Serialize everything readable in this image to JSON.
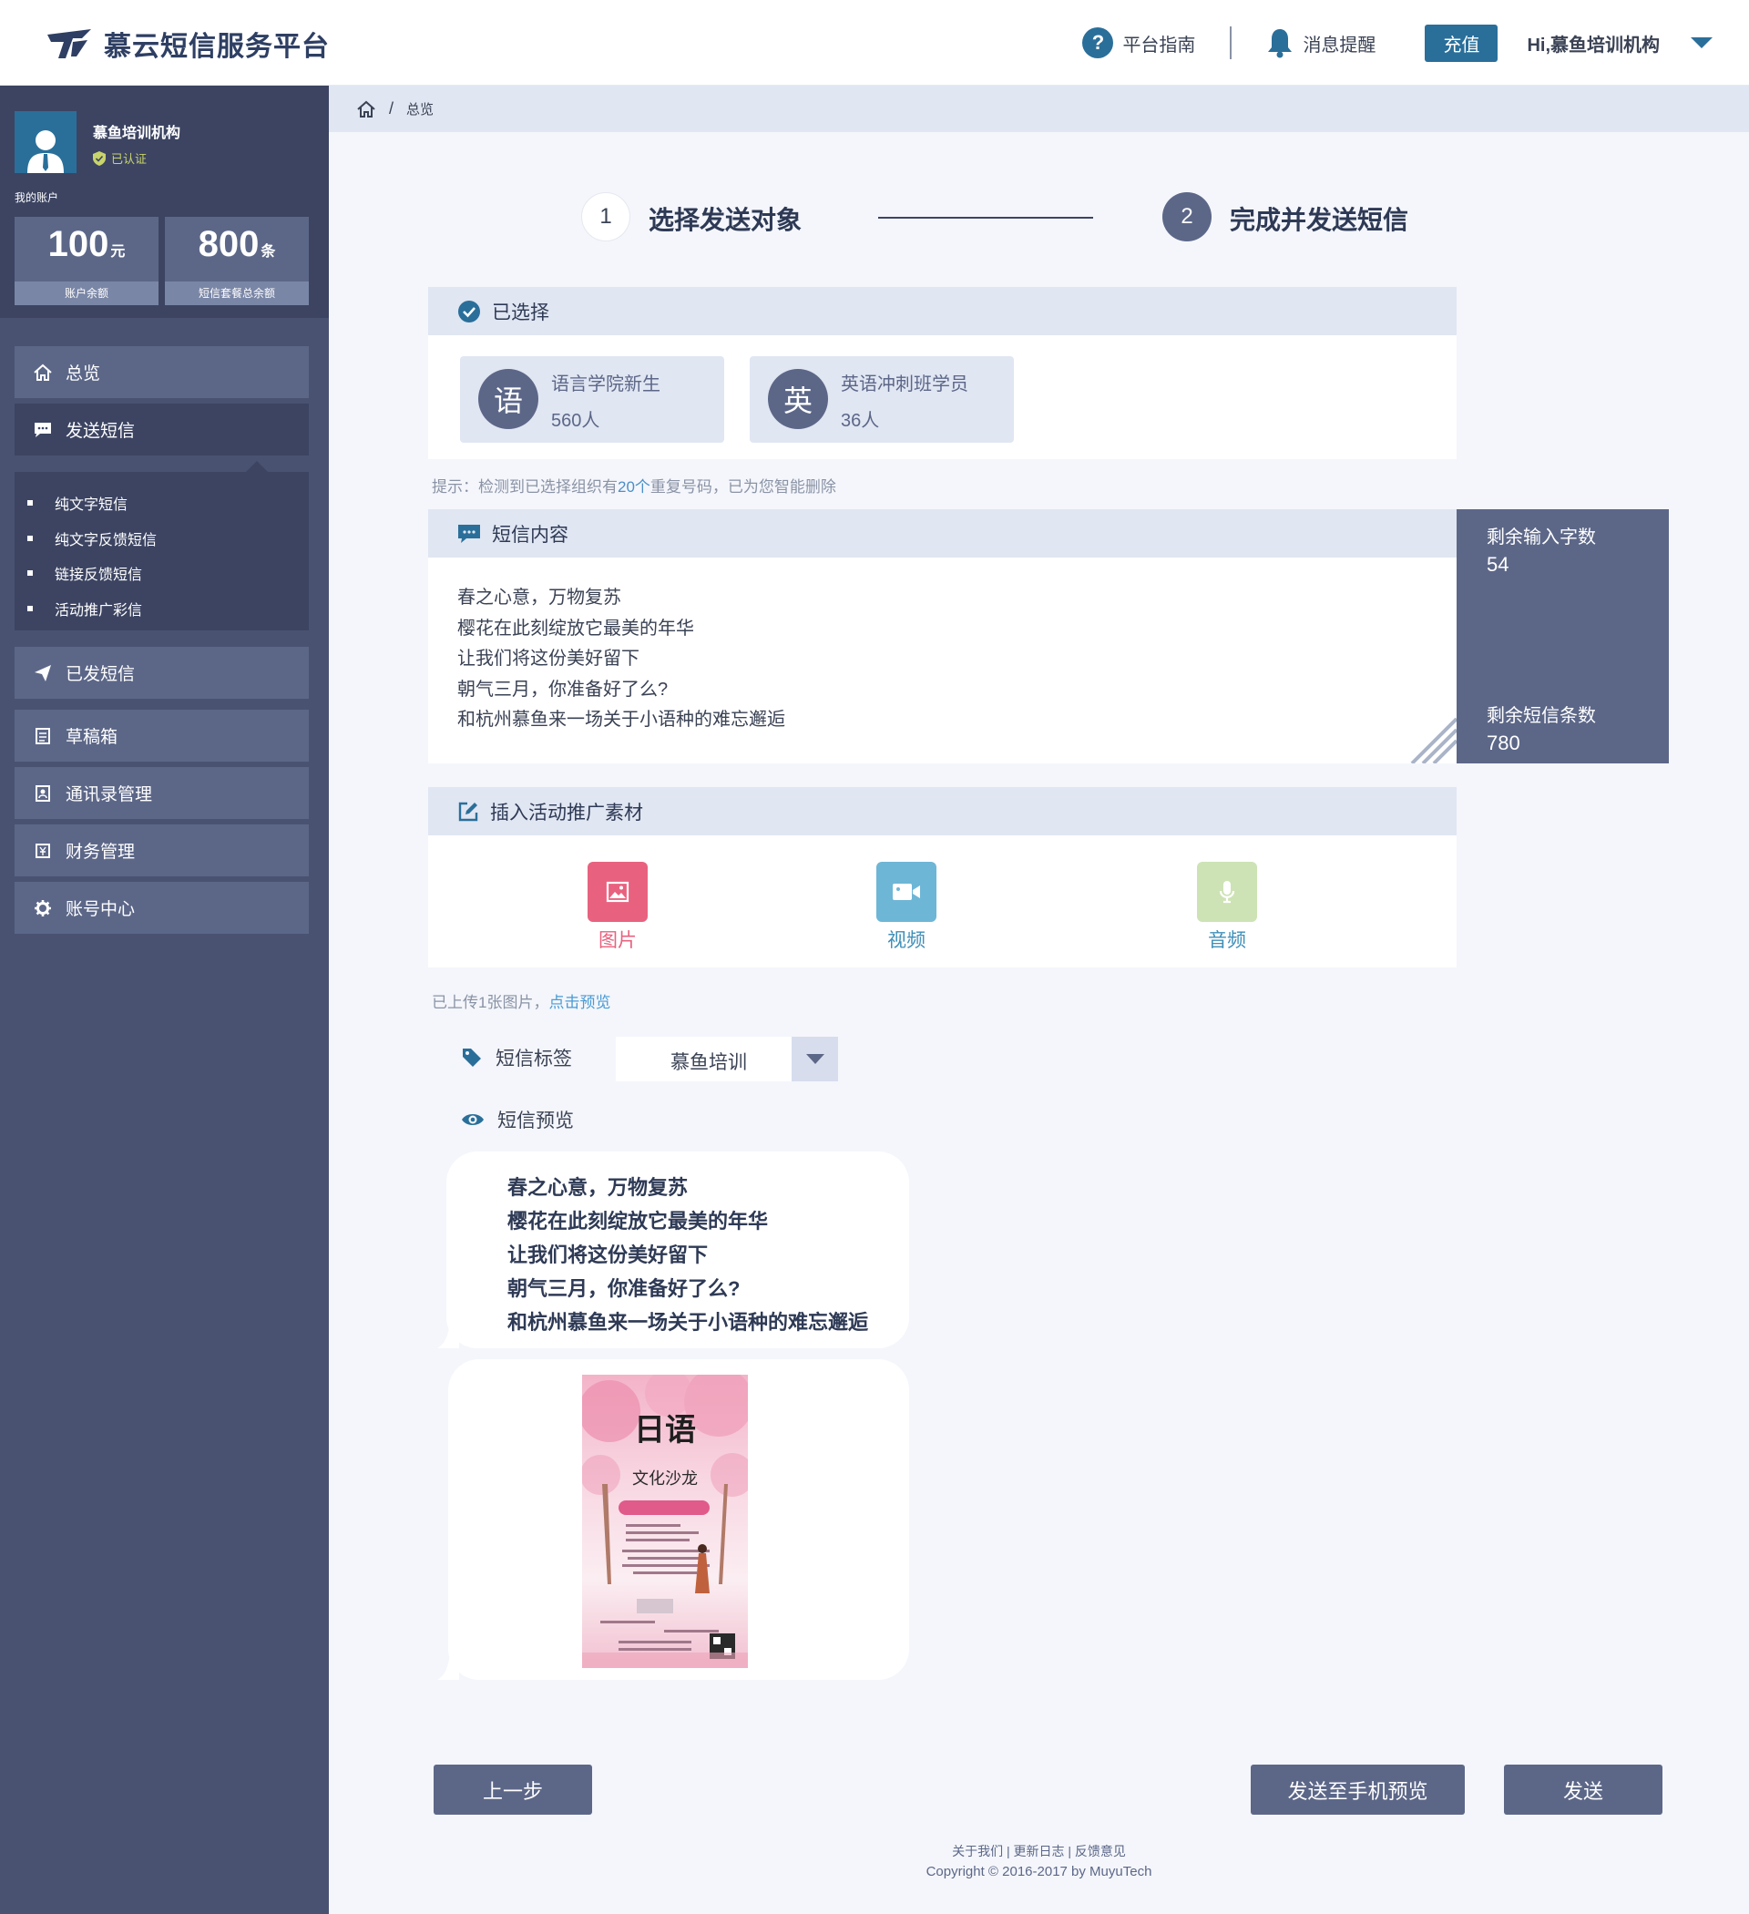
{
  "header": {
    "brand": "慕云短信服务平台",
    "guide": "平台指南",
    "notifications": "消息提醒",
    "recharge": "充值",
    "greeting": "Hi,慕鱼培训机构"
  },
  "account": {
    "org_name": "慕鱼培训机构",
    "verified": "已认证",
    "my_account": "我的账户",
    "balance_value": "100",
    "balance_unit": "元",
    "balance_label": "账户余额",
    "package_value": "800",
    "package_unit": "条",
    "package_label": "短信套餐总余额"
  },
  "sidebar": {
    "items": [
      {
        "label": "总览",
        "icon": "home-icon"
      },
      {
        "label": "发送短信",
        "icon": "chat-icon"
      },
      {
        "label": "已发短信",
        "icon": "send-icon"
      },
      {
        "label": "草稿箱",
        "icon": "draft-icon"
      },
      {
        "label": "通讯录管理",
        "icon": "contacts-icon"
      },
      {
        "label": "财务管理",
        "icon": "finance-icon"
      },
      {
        "label": "账号中心",
        "icon": "gear-icon"
      }
    ],
    "submenu": [
      "纯文字短信",
      "纯文字反馈短信",
      "链接反馈短信",
      "活动推广彩信"
    ]
  },
  "breadcrumb": {
    "sep": "/",
    "current": "总览"
  },
  "steps": [
    {
      "num": "1",
      "label": "选择发送对象"
    },
    {
      "num": "2",
      "label": "完成并发送短信"
    }
  ],
  "selected": {
    "title": "已选择",
    "groups": [
      {
        "badge": "语",
        "name": "语言学院新生",
        "count": "560人"
      },
      {
        "badge": "英",
        "name": "英语冲刺班学员",
        "count": "36人"
      }
    ],
    "tip_prefix": "提示：检测到已选择组织有",
    "tip_highlight": "20个",
    "tip_suffix": "重复号码，已为您智能删除"
  },
  "content": {
    "title": "短信内容",
    "lines": [
      "春之心意，万物复苏",
      "樱花在此刻绽放它最美的年华",
      "让我们将这份美好留下",
      "朝气三月，你准备好了么?",
      "和杭州慕鱼来一场关于小语种的难忘邂逅"
    ],
    "remaining_chars_label": "剩余输入字数",
    "remaining_chars": "54",
    "remaining_sms_label": "剩余短信条数",
    "remaining_sms": "780"
  },
  "media": {
    "title": "插入活动推广素材",
    "items": [
      {
        "label": "图片",
        "color": "#e8627f",
        "label_color": "#e8627f"
      },
      {
        "label": "视频",
        "color": "#6eb6d6",
        "label_color": "#3f8fb8"
      },
      {
        "label": "音频",
        "color": "#cde3b5",
        "label_color": "#3f8fb8"
      }
    ],
    "uploaded_text": "已上传1张图片，",
    "preview_link": "点击预览"
  },
  "tag": {
    "label": "短信标签",
    "value": "慕鱼培训"
  },
  "preview": {
    "label": "短信预览",
    "lines": [
      "春之心意，万物复苏",
      "樱花在此刻绽放它最美的年华",
      "让我们将这份美好留下",
      "朝气三月，你准备好了么?",
      "和杭州慕鱼来一场关于小语种的难忘邂逅"
    ],
    "poster_title": "日语",
    "poster_subtitle": "文化沙龙"
  },
  "buttons": {
    "prev": "上一步",
    "preview_phone": "发送至手机预览",
    "send": "发送"
  },
  "footer": {
    "links": [
      "关于我们",
      "更新日志",
      "反馈意见"
    ],
    "copyright": "Copyright © 2016-2017 by MuyuTech"
  }
}
